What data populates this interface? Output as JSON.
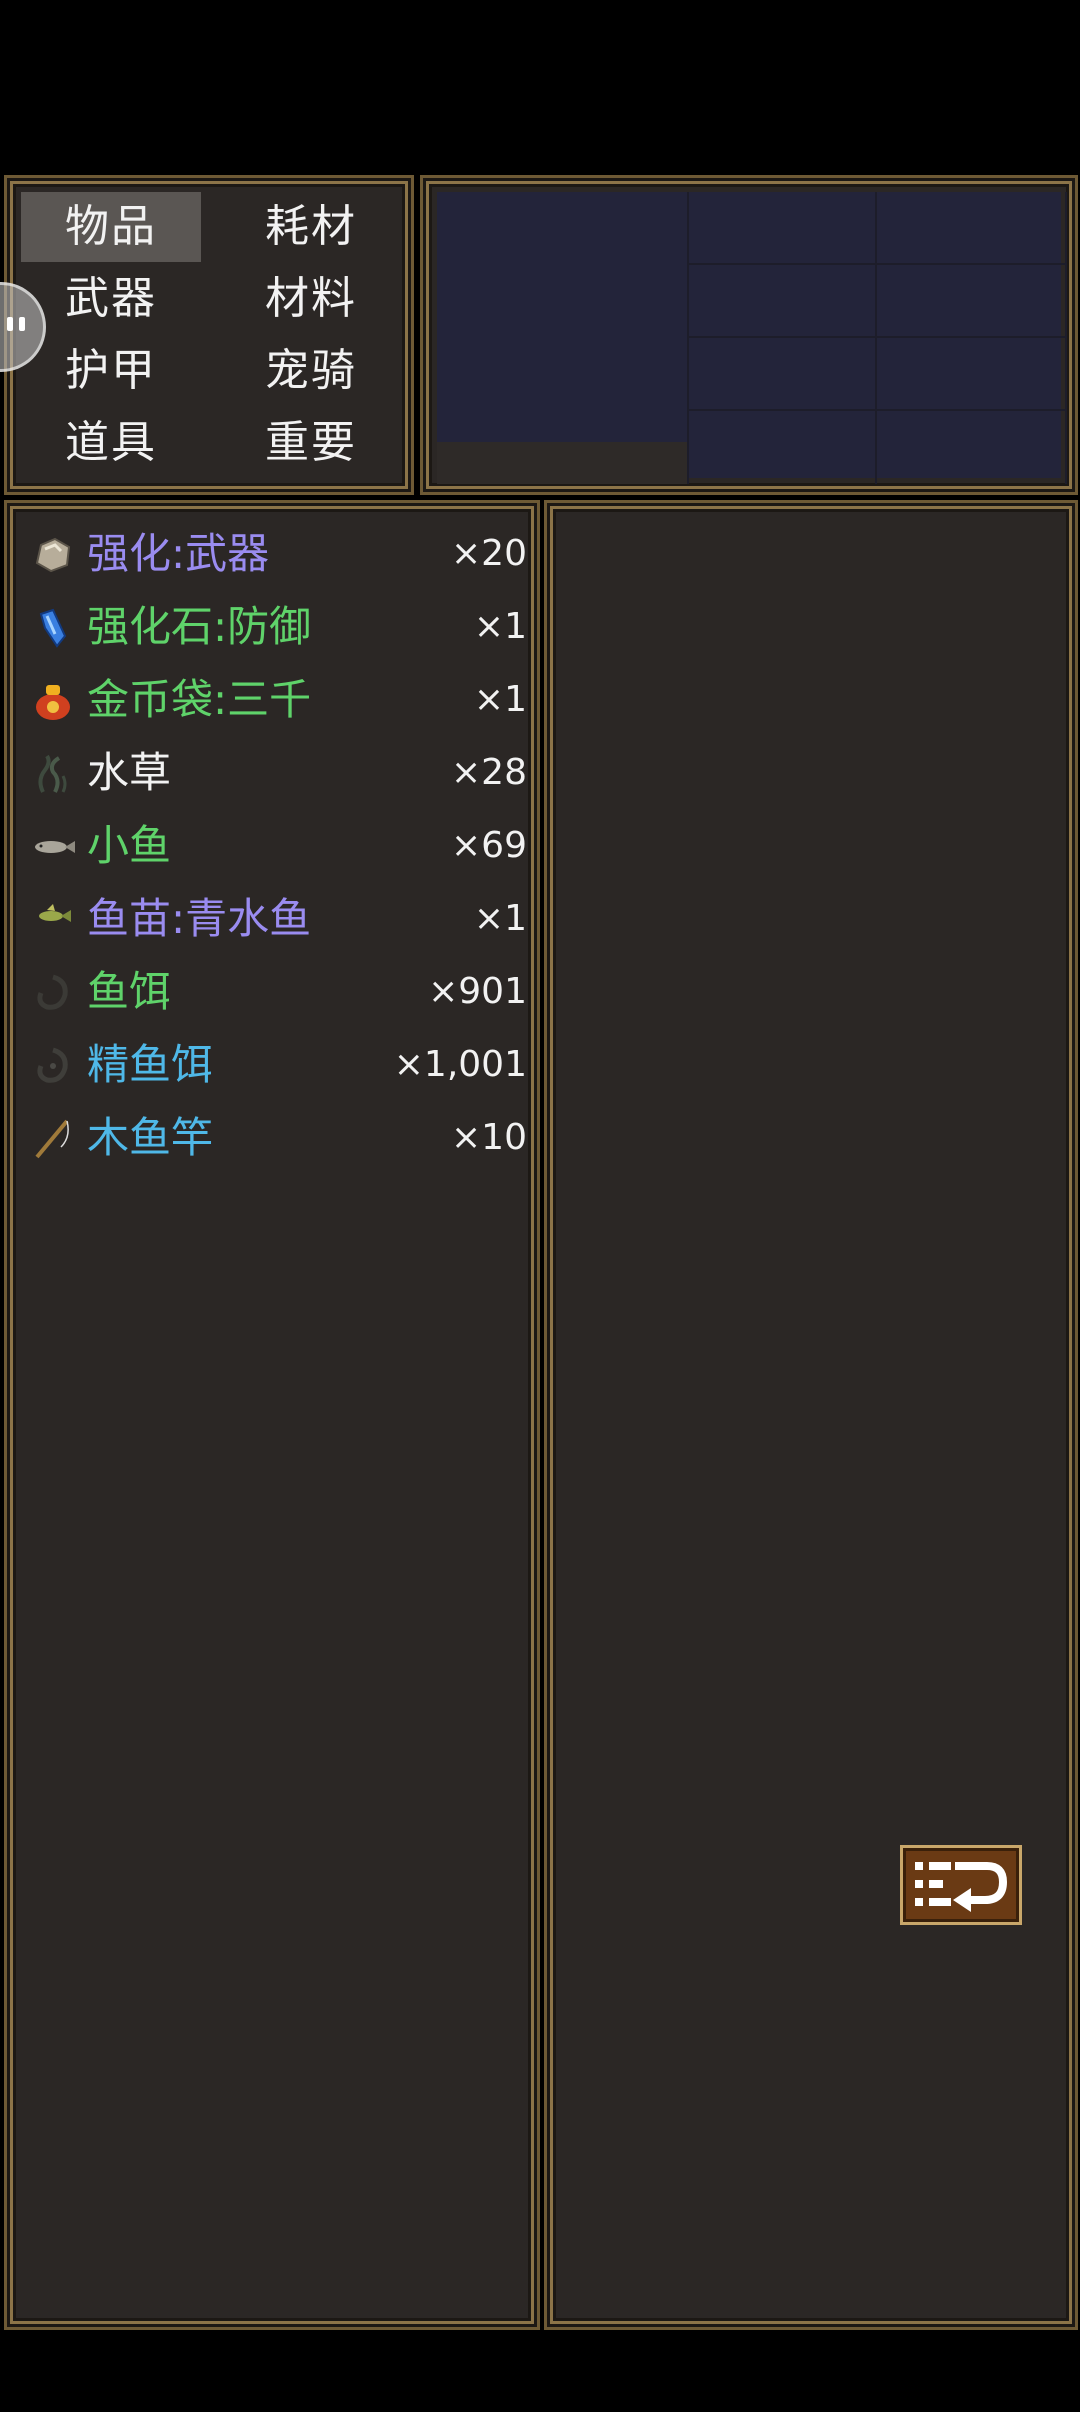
{
  "categories": [
    {
      "label": "物品",
      "active": true
    },
    {
      "label": "耗材",
      "active": false
    },
    {
      "label": "武器",
      "active": false
    },
    {
      "label": "材料",
      "active": false
    },
    {
      "label": "护甲",
      "active": false
    },
    {
      "label": "宠骑",
      "active": false
    },
    {
      "label": "道具",
      "active": false
    },
    {
      "label": "重要",
      "active": false
    }
  ],
  "items": [
    {
      "name": "强化:武器",
      "count": "×20",
      "color": "#9a8cf0",
      "icon": "stone-icon"
    },
    {
      "name": "强化石:防御",
      "count": "×1",
      "color": "#5fd36a",
      "icon": "blue-crystal-icon"
    },
    {
      "name": "金币袋:三千",
      "count": "×1",
      "color": "#5fd36a",
      "icon": "gold-bag-icon"
    },
    {
      "name": "水草",
      "count": "×28",
      "color": "#f2f2f2",
      "icon": "seaweed-icon"
    },
    {
      "name": "小鱼",
      "count": "×69",
      "color": "#5fd36a",
      "icon": "small-fish-icon"
    },
    {
      "name": "鱼苗:青水鱼",
      "count": "×1",
      "color": "#9a8cf0",
      "icon": "fry-icon"
    },
    {
      "name": "鱼饵",
      "count": "×901",
      "color": "#5fd36a",
      "icon": "bait-icon"
    },
    {
      "name": "精鱼饵",
      "count": "×1,001",
      "color": "#4fb8e8",
      "icon": "fine-bait-icon"
    },
    {
      "name": "木鱼竿",
      "count": "×10",
      "color": "#4fb8e8",
      "icon": "fishing-rod-icon"
    }
  ],
  "sort_button": {
    "icon": "sort-icon"
  },
  "float_ball": {
    "icon": "assistant-icon"
  }
}
